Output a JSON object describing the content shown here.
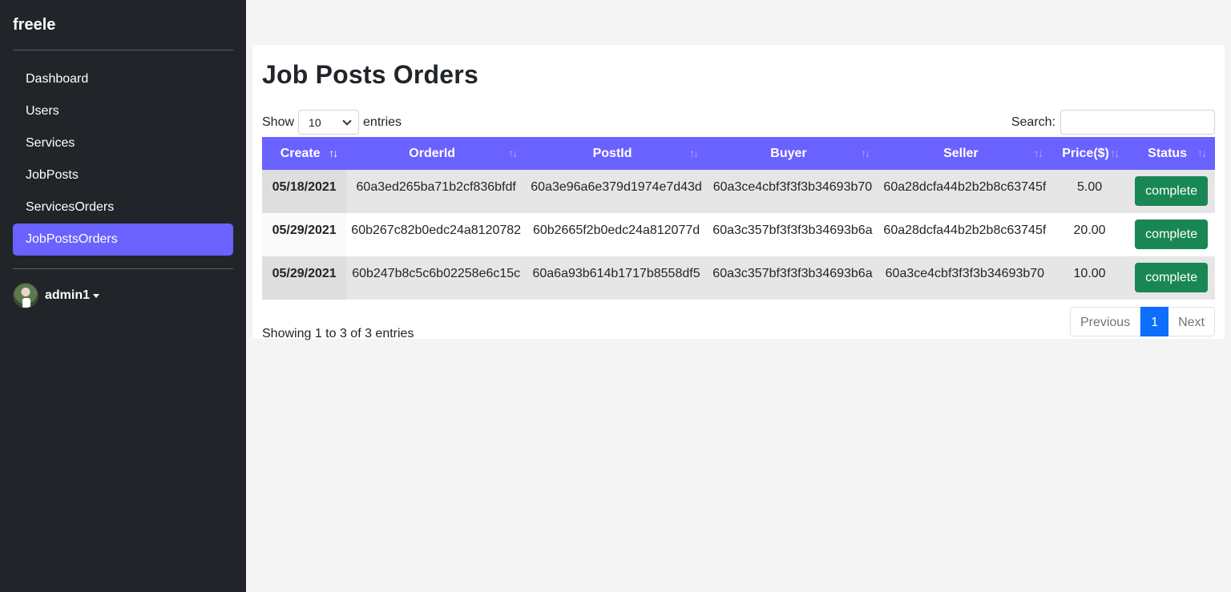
{
  "brand": "freele",
  "nav": [
    {
      "label": "Dashboard",
      "active": false
    },
    {
      "label": "Users",
      "active": false
    },
    {
      "label": "Services",
      "active": false
    },
    {
      "label": "JobPosts",
      "active": false
    },
    {
      "label": "ServicesOrders",
      "active": false
    },
    {
      "label": "JobPostsOrders",
      "active": true
    }
  ],
  "user": {
    "name": "admin1"
  },
  "page": {
    "title": "Job Posts Orders"
  },
  "controls": {
    "show_label": "Show",
    "entries_value": "10",
    "entries_label": "entries",
    "search_label": "Search:",
    "search_value": ""
  },
  "table": {
    "columns": [
      "Create",
      "OrderId",
      "PostId",
      "Buyer",
      "Seller",
      "Price($)",
      "Status"
    ],
    "sort_icon": "↑↓",
    "rows": [
      {
        "create": "05/18/2021",
        "orderId": "60a3ed265ba71b2cf836bfdf",
        "postId": "60a3e96a6e379d1974e7d43d",
        "buyer": "60a3ce4cbf3f3f3b34693b70",
        "seller": "60a28dcfa44b2b2b8c63745f",
        "price": "5.00",
        "status": "complete"
      },
      {
        "create": "05/29/2021",
        "orderId": "60b267c82b0edc24a8120782",
        "postId": "60b2665f2b0edc24a812077d",
        "buyer": "60a3c357bf3f3f3b34693b6a",
        "seller": "60a28dcfa44b2b2b8c63745f",
        "price": "20.00",
        "status": "complete"
      },
      {
        "create": "05/29/2021",
        "orderId": "60b247b8c5c6b02258e6c15c",
        "postId": "60a6a93b614b1717b8558df5",
        "buyer": "60a3c357bf3f3f3b34693b6a",
        "seller": "60a3ce4cbf3f3f3b34693b70",
        "price": "10.00",
        "status": "complete"
      }
    ]
  },
  "footer": {
    "info": "Showing 1 to 3 of 3 entries",
    "previous": "Previous",
    "current_page": "1",
    "next": "Next"
  },
  "colors": {
    "sidebar_bg": "#212529",
    "accent": "#6a62ff",
    "status_green": "#198754",
    "page_active": "#0d6efd"
  }
}
